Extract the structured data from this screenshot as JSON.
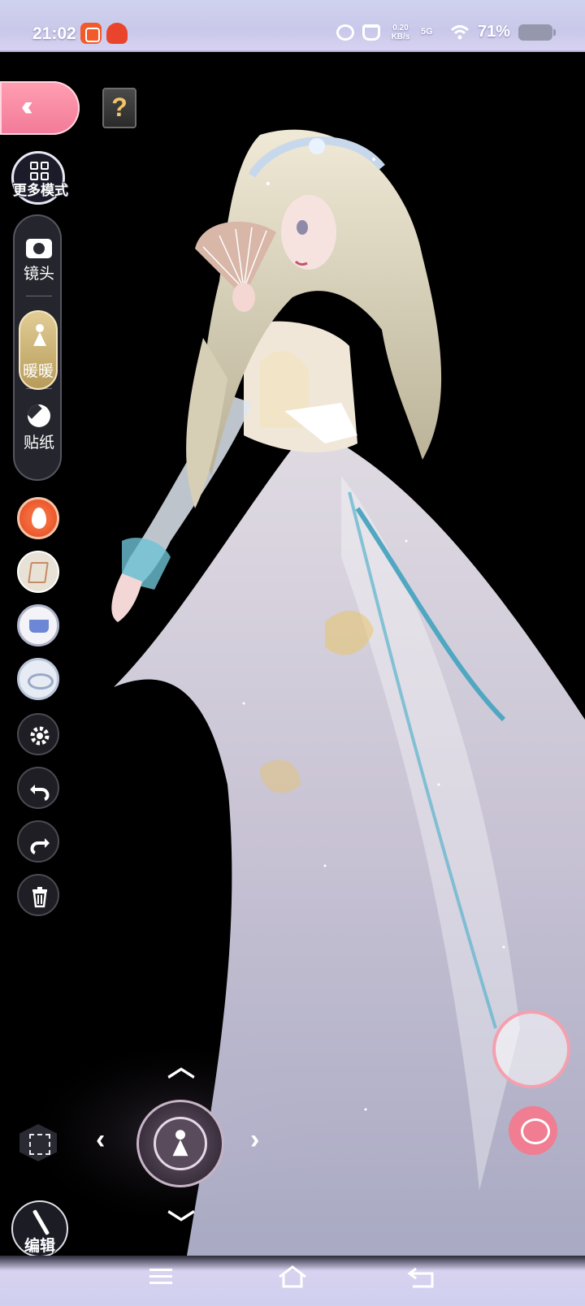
{
  "status_bar": {
    "time": "21:02",
    "net_speed": "0.20 KB/s",
    "network_type": "5G",
    "battery_percent": "71%"
  },
  "toolbar": {
    "more_modes_label": "更多模式",
    "camera_label": "镜头",
    "warm_label": "暖暖",
    "sticker_label": "贴纸",
    "edit_label": "编辑"
  },
  "icons": {
    "back": "double-chevron-left-icon",
    "help": "question-book-icon",
    "more_modes": "grid-icon",
    "camera": "camera-icon",
    "warm": "girl-icon",
    "sticker": "sticker-icon",
    "fire": "fire-icon",
    "swap": "swap-outfit-icon",
    "basket": "basket-icon",
    "eye": "eye-icon",
    "settings": "gear-icon",
    "undo": "undo-icon",
    "redo": "redo-icon",
    "delete": "trash-icon",
    "joystick": "character-joystick-icon",
    "fullscreen": "fullscreen-icon",
    "edit": "magic-wand-icon",
    "capture": "capture-shutter-icon",
    "chat": "chat-face-icon"
  },
  "colors": {
    "accent_pink": "#f27a98",
    "warm_gold": "#c8ad6d",
    "status_bg": "#cfd2ee"
  }
}
